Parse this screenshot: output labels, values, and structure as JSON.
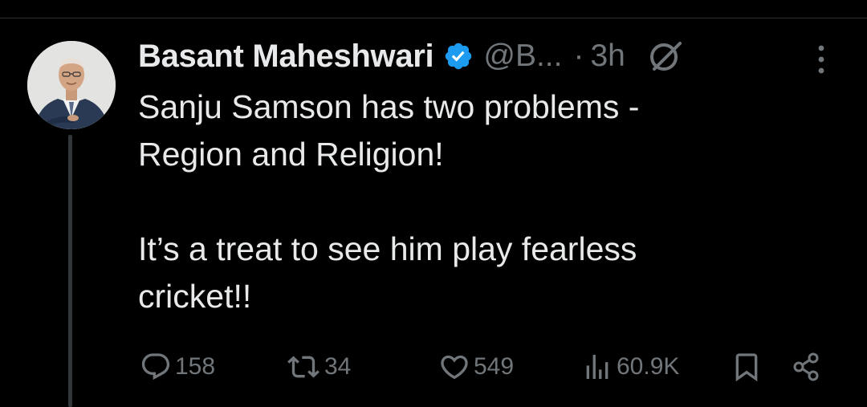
{
  "tweet": {
    "author_name": "Basant Maheshwari",
    "handle": "@B...",
    "separator": "·",
    "time": "3h",
    "verified": true,
    "paragraphs": [
      [
        "Sanju Samson has two problems -",
        "Region and Religion!"
      ],
      [
        "It’s a treat to see him play fearless",
        "cricket!!"
      ]
    ]
  },
  "actions": {
    "replies": "158",
    "reposts": "34",
    "likes": "549",
    "views": "60.9K"
  },
  "icons": [
    "verified-badge-icon",
    "grok-icon",
    "more-icon",
    "reply-icon",
    "repost-icon",
    "like-icon",
    "views-icon",
    "bookmark-icon",
    "share-icon"
  ],
  "colors": {
    "background": "#000000",
    "text": "#e7e9ea",
    "muted": "#71767b",
    "verified": "#1d9bf0",
    "divider": "#2f3336"
  }
}
